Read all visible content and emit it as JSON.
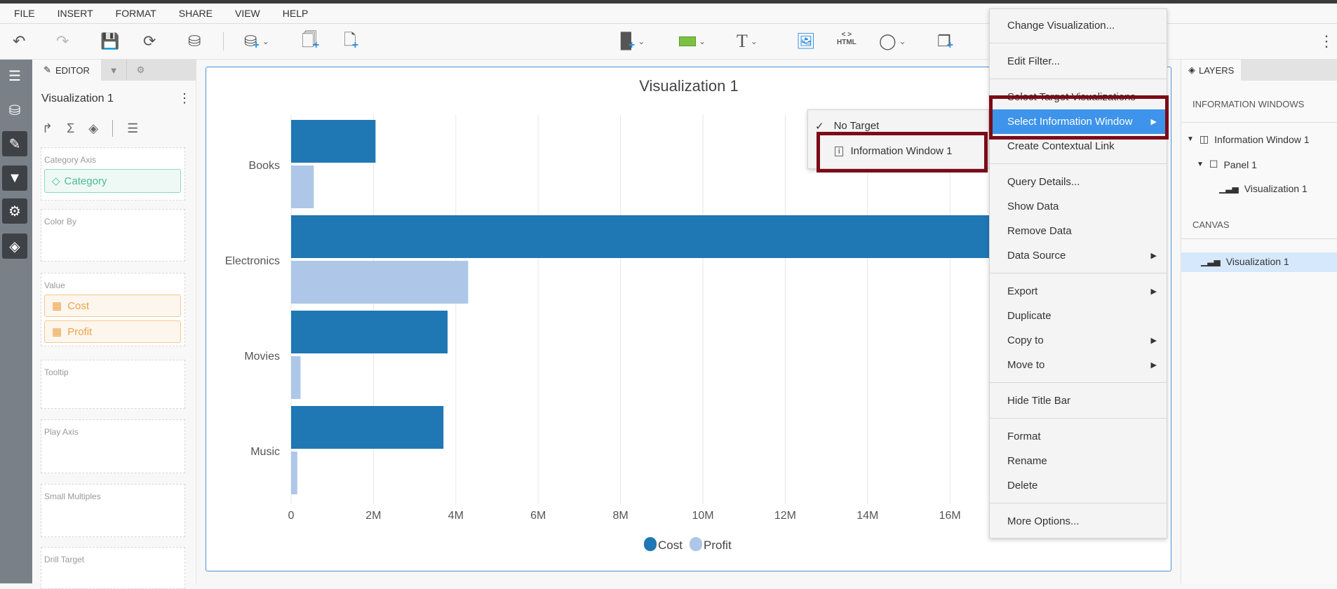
{
  "menubar": [
    "FILE",
    "INSERT",
    "FORMAT",
    "SHARE",
    "VIEW",
    "HELP"
  ],
  "toolbar": {
    "html_label": "HTML"
  },
  "editor": {
    "tab_label": "EDITOR",
    "title": "Visualization 1",
    "sections": {
      "category_axis": "Category Axis",
      "category_field": "Category",
      "color_by": "Color By",
      "value": "Value",
      "value_fields": [
        "Cost",
        "Profit"
      ],
      "tooltip": "Tooltip",
      "play_axis": "Play Axis",
      "small_multiples": "Small Multiples",
      "drill_target": "Drill Target"
    }
  },
  "chart_data": {
    "type": "bar",
    "orientation": "horizontal",
    "title": "Visualization 1",
    "categories": [
      "Books",
      "Electronics",
      "Movies",
      "Music"
    ],
    "series": [
      {
        "name": "Cost",
        "color": "#1f77b4",
        "values": [
          2.05,
          18.5,
          3.8,
          3.7
        ]
      },
      {
        "name": "Profit",
        "color": "#aec7e8",
        "values": [
          0.55,
          4.3,
          0.23,
          0.15
        ]
      }
    ],
    "xticks": [
      "0",
      "2M",
      "4M",
      "6M",
      "8M",
      "10M",
      "12M",
      "14M",
      "16M"
    ],
    "xlim": [
      0,
      18
    ],
    "unit": "M",
    "grid": true,
    "legend": "bottom"
  },
  "context_menu": {
    "groups": [
      [
        {
          "label": "Change Visualization..."
        }
      ],
      [
        {
          "label": "Edit Filter..."
        }
      ],
      [
        {
          "label": "Select Target Visualizations"
        },
        {
          "label": "Select Information Window",
          "submenu": true,
          "highlighted": true
        },
        {
          "label": "Create Contextual Link"
        }
      ],
      [
        {
          "label": "Query Details..."
        },
        {
          "label": "Show Data"
        },
        {
          "label": "Remove Data"
        },
        {
          "label": "Data Source",
          "submenu": true
        }
      ],
      [
        {
          "label": "Export",
          "submenu": true
        },
        {
          "label": "Duplicate"
        },
        {
          "label": "Copy to",
          "submenu": true
        },
        {
          "label": "Move to",
          "submenu": true
        }
      ],
      [
        {
          "label": "Hide Title Bar"
        }
      ],
      [
        {
          "label": "Format"
        },
        {
          "label": "Rename"
        },
        {
          "label": "Delete"
        }
      ],
      [
        {
          "label": "More Options..."
        }
      ]
    ]
  },
  "submenu": {
    "no_target": "No Target",
    "info_window": "Information Window 1"
  },
  "layers": {
    "tab_label": "LAYERS",
    "info_header": "INFORMATION WINDOWS",
    "info_window": "Information Window 1",
    "panel": "Panel 1",
    "panel_viz": "Visualization 1",
    "canvas_header": "CANVAS",
    "canvas_viz": "Visualization 1"
  },
  "colors": {
    "accent": "#3d94ea",
    "highlight_box": "#7b0b17",
    "cost": "#1f77b4",
    "profit": "#aec7e8"
  }
}
